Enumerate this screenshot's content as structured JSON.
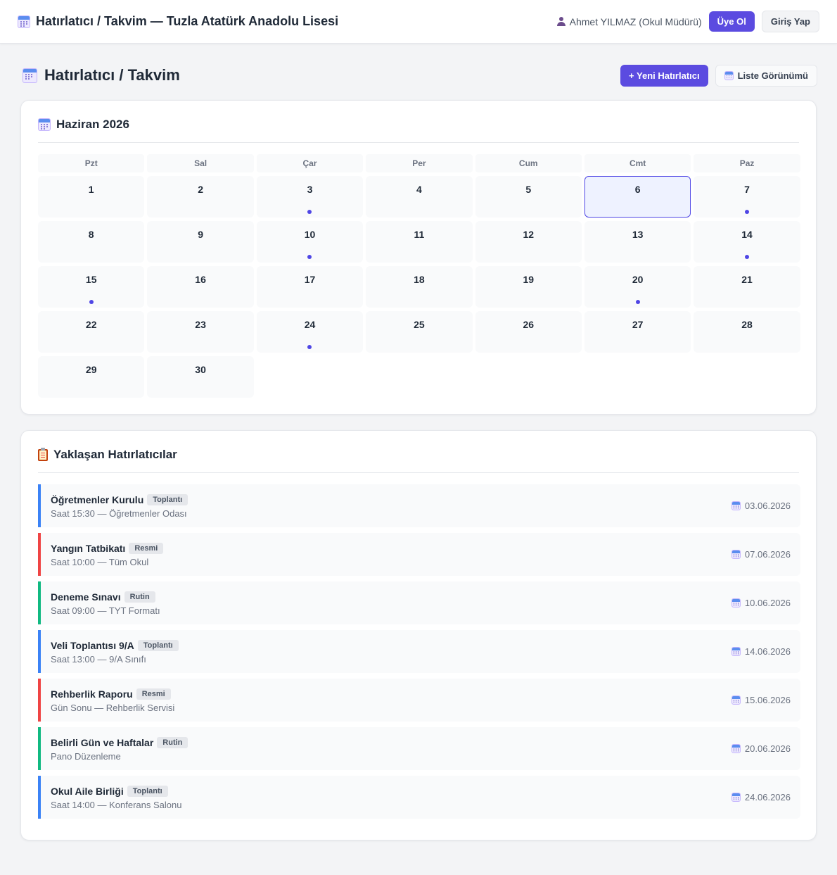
{
  "header": {
    "title": "Hatırlatıcı / Takvim — Tuzla Atatürk Anadolu Lisesi",
    "user": "Ahmet YILMAZ (Okul Müdürü)",
    "signup_label": "Üye Ol",
    "login_label": "Giriş Yap"
  },
  "page": {
    "title": "Hatırlatıcı / Takvim",
    "new_button": "+ Yeni Hatırlatıcı",
    "list_view_button": "Liste Görünümü"
  },
  "calendar": {
    "month_title": "Haziran 2026",
    "weekdays": [
      "Pzt",
      "Sal",
      "Çar",
      "Per",
      "Cum",
      "Cmt",
      "Paz"
    ],
    "leading_blanks": 0,
    "days_in_month": 30,
    "today": 6,
    "event_days": [
      3,
      7,
      10,
      14,
      15,
      20,
      24
    ]
  },
  "upcoming": {
    "title": "Yaklaşan Hatırlatıcılar",
    "items": [
      {
        "title": "Öğretmenler Kurulu",
        "tag": "Toplantı",
        "detail": "Saat 15:30 — Öğretmenler Odası",
        "date": "03.06.2026",
        "color": "#3b82f6"
      },
      {
        "title": "Yangın Tatbikatı",
        "tag": "Resmi",
        "detail": "Saat 10:00 — Tüm Okul",
        "date": "07.06.2026",
        "color": "#ef4444"
      },
      {
        "title": "Deneme Sınavı",
        "tag": "Rutin",
        "detail": "Saat 09:00 — TYT Formatı",
        "date": "10.06.2026",
        "color": "#10b981"
      },
      {
        "title": "Veli Toplantısı 9/A",
        "tag": "Toplantı",
        "detail": "Saat 13:00 — 9/A Sınıfı",
        "date": "14.06.2026",
        "color": "#3b82f6"
      },
      {
        "title": "Rehberlik Raporu",
        "tag": "Resmi",
        "detail": "Gün Sonu — Rehberlik Servisi",
        "date": "15.06.2026",
        "color": "#ef4444"
      },
      {
        "title": "Belirli Gün ve Haftalar",
        "tag": "Rutin",
        "detail": "Pano Düzenleme",
        "date": "20.06.2026",
        "color": "#10b981"
      },
      {
        "title": "Okul Aile Birliği",
        "tag": "Toplantı",
        "detail": "Saat 14:00 — Konferans Salonu",
        "date": "24.06.2026",
        "color": "#3b82f6"
      }
    ]
  },
  "icons": {
    "calendar": "calendar-icon",
    "user": "user-icon",
    "clipboard": "clipboard-icon"
  }
}
